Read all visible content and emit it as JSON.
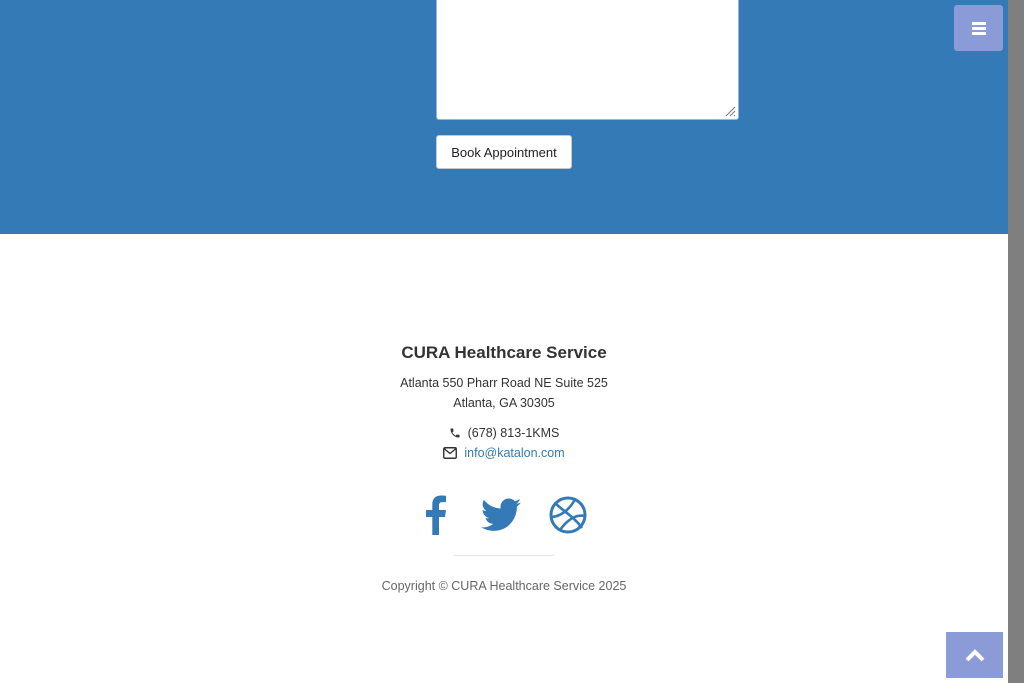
{
  "appointment": {
    "comment_value": "",
    "book_button_label": "Book Appointment"
  },
  "footer": {
    "company": "CURA Healthcare Service",
    "address_line1": "Atlanta 550 Pharr Road NE Suite 525",
    "address_line2": "Atlanta, GA 30305",
    "phone": "(678) 813-1KMS",
    "email": "info@katalon.com",
    "social": [
      {
        "icon": "facebook-icon"
      },
      {
        "icon": "twitter-icon"
      },
      {
        "icon": "dribbble-icon"
      }
    ],
    "copyright": "Copyright © CURA Healthcare Service 2025"
  },
  "colors": {
    "primary": "#337ab7",
    "accent_button": "#8a9bd8",
    "background": "#ffffff",
    "text": "#333333"
  }
}
